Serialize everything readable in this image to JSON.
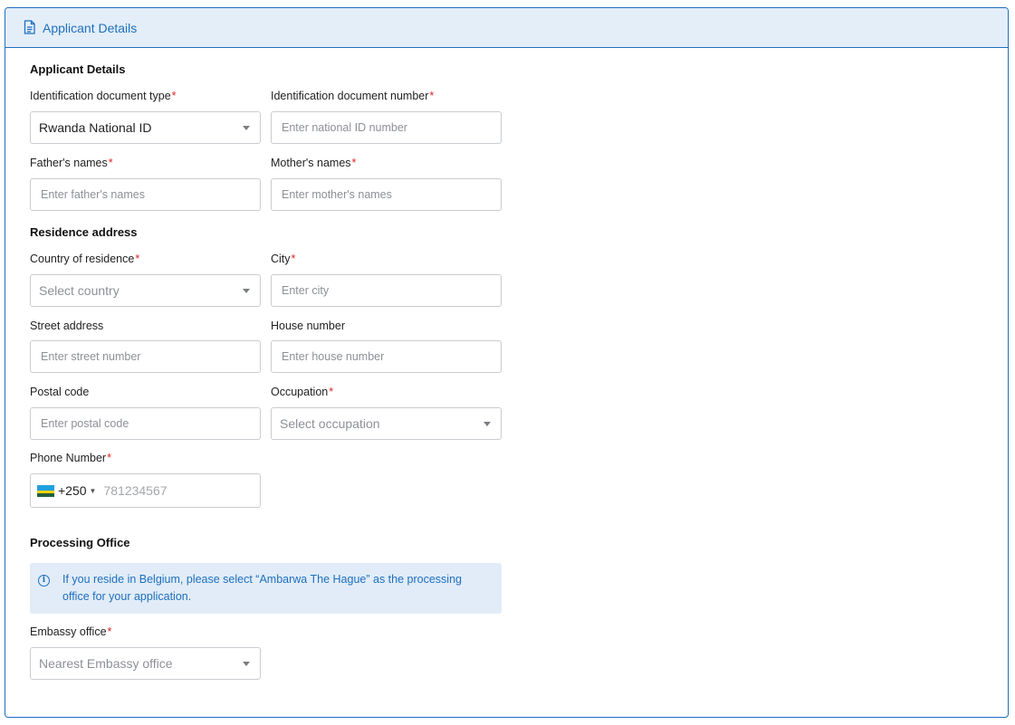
{
  "header": {
    "title": "Applicant Details",
    "icon": "document-icon"
  },
  "sections": {
    "applicant": "Applicant Details",
    "residence": "Residence address",
    "processing": "Processing Office"
  },
  "fields": {
    "id_type": {
      "label": "Identification document type",
      "value": "Rwanda National ID"
    },
    "id_number": {
      "label": "Identification document number",
      "placeholder": "Enter national ID number"
    },
    "father": {
      "label": "Father's names",
      "placeholder": "Enter father's names"
    },
    "mother": {
      "label": "Mother's names",
      "placeholder": "Enter mother's names"
    },
    "country": {
      "label": "Country of residence",
      "placeholder": "Select country"
    },
    "city": {
      "label": "City",
      "placeholder": "Enter city"
    },
    "street": {
      "label": "Street address",
      "placeholder": "Enter street number"
    },
    "house": {
      "label": "House number",
      "placeholder": "Enter house number"
    },
    "postal": {
      "label": "Postal code",
      "placeholder": "Enter postal code"
    },
    "occupation": {
      "label": "Occupation",
      "placeholder": "Select occupation"
    },
    "phone": {
      "label": "Phone Number",
      "dial_code": "+250",
      "placeholder": "781234567"
    },
    "embassy": {
      "label": "Embassy office",
      "placeholder": "Nearest Embassy office"
    }
  },
  "required_marker": "*",
  "info": {
    "text": "If you reside in Belgium, please select “Ambarwa The Hague” as the processing office for your application."
  },
  "colors": {
    "accent": "#1f6fbd",
    "header_bg": "#e3eef9",
    "required": "#e02424",
    "info_bg": "#e1ecf8"
  }
}
